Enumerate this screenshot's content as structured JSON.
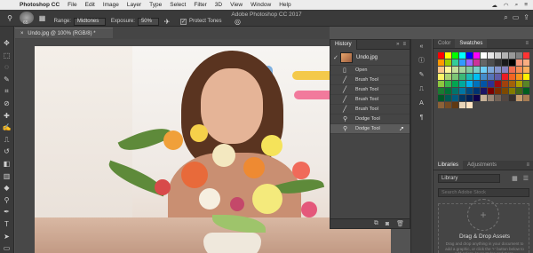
{
  "menubar": {
    "app_name": "Photoshop CC",
    "items": [
      "File",
      "Edit",
      "Image",
      "Layer",
      "Type",
      "Select",
      "Filter",
      "3D",
      "View",
      "Window",
      "Help"
    ]
  },
  "window": {
    "title": "Adobe Photoshop CC 2017"
  },
  "options": {
    "brush_size": "65",
    "range_label": "Range:",
    "range_value": "Midtones",
    "exposure_label": "Exposure:",
    "exposure_value": "50%",
    "protect_tones_label": "Protect Tones"
  },
  "document": {
    "tab_label": "Undo.jpg @ 100% (RGB/8) *"
  },
  "history": {
    "tab_label": "History",
    "snapshot_label": "Undo.jpg",
    "states": [
      "Open",
      "Brush Tool",
      "Brush Tool",
      "Brush Tool",
      "Brush Tool",
      "Dodge Tool",
      "Dodge Tool"
    ],
    "selected_index": 6
  },
  "swatch_panel": {
    "tabs": [
      "Color",
      "Swatches"
    ],
    "active_tab": "Swatches"
  },
  "libraries": {
    "tabs": [
      "Libraries",
      "Adjustments"
    ],
    "active_tab": "Libraries",
    "library_select": "Library",
    "search_placeholder": "Search Adobe Stock",
    "drop_title": "Drag & Drop Assets",
    "drop_desc": "Drag and drop anything in your document to add a graphic, or click the '+' button below to add colors, layer styles and more."
  },
  "colors": {
    "accent": "#2d6bd1",
    "panel_bg": "#454545",
    "canvas_bg": "#484848"
  }
}
